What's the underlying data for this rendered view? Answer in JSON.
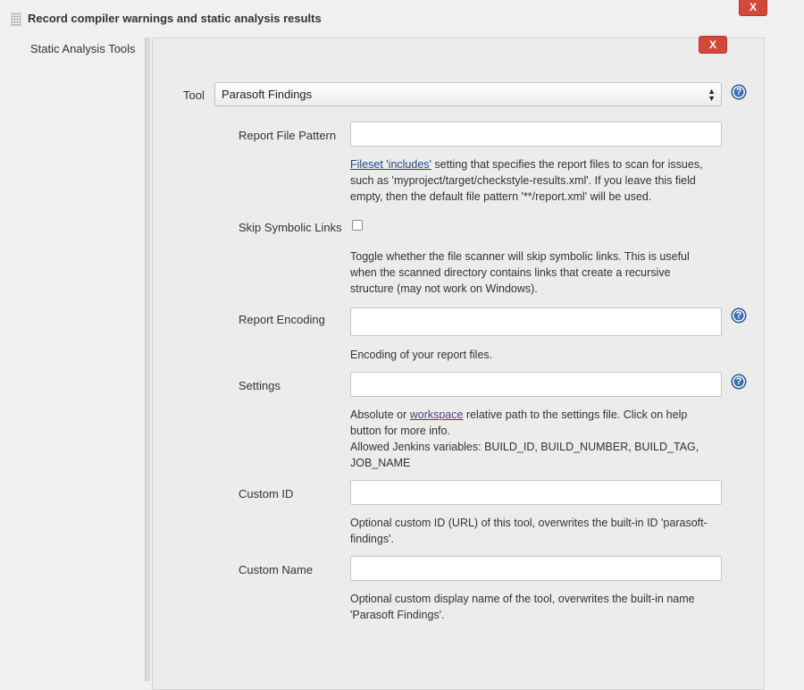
{
  "section": {
    "title": "Record compiler warnings and static analysis results",
    "close_label": "X"
  },
  "left_label": "Static Analysis Tools",
  "tool_panel": {
    "close_label": "X",
    "tool": {
      "label": "Tool",
      "selected": "Parasoft Findings",
      "help": "?"
    },
    "report_file_pattern": {
      "label": "Report File Pattern",
      "value": "",
      "desc_link": "Fileset 'includes'",
      "desc_line1": " setting that specifies the report files to scan for issues,",
      "desc_line2": "such as 'myproject/target/checkstyle-results.xml'. If you leave this field",
      "desc_line3": "empty, then the default file pattern '**/report.xml' will be used."
    },
    "skip_symbolic_links": {
      "label": "Skip Symbolic Links",
      "checked": false,
      "desc_line1": "Toggle whether the file scanner will skip symbolic links. This is useful",
      "desc_line2": "when the scanned directory contains links that create a recursive",
      "desc_line3": "structure (may not work on Windows)."
    },
    "report_encoding": {
      "label": "Report Encoding",
      "value": "",
      "help": "?",
      "desc": "Encoding of your report files."
    },
    "settings": {
      "label": "Settings",
      "value": "",
      "help": "?",
      "desc_prefix": "Absolute or ",
      "desc_link": "workspace",
      "desc_suffix": " relative path to the settings file. Click on help",
      "desc_line2": "button for more info.",
      "desc_line3": "Allowed Jenkins variables: BUILD_ID, BUILD_NUMBER, BUILD_TAG,",
      "desc_line4": "JOB_NAME"
    },
    "custom_id": {
      "label": "Custom ID",
      "value": "",
      "desc_line1": "Optional custom ID (URL) of this tool, overwrites the built-in ID 'parasoft-",
      "desc_line2": "findings'."
    },
    "custom_name": {
      "label": "Custom Name",
      "value": "",
      "desc_line1": "Optional custom display name of the tool, overwrites the built-in name",
      "desc_line2": "'Parasoft Findings'."
    }
  },
  "colors": {
    "close_button": "#d24939",
    "help_icon": "#3a6fb0",
    "link": "#204a87"
  }
}
